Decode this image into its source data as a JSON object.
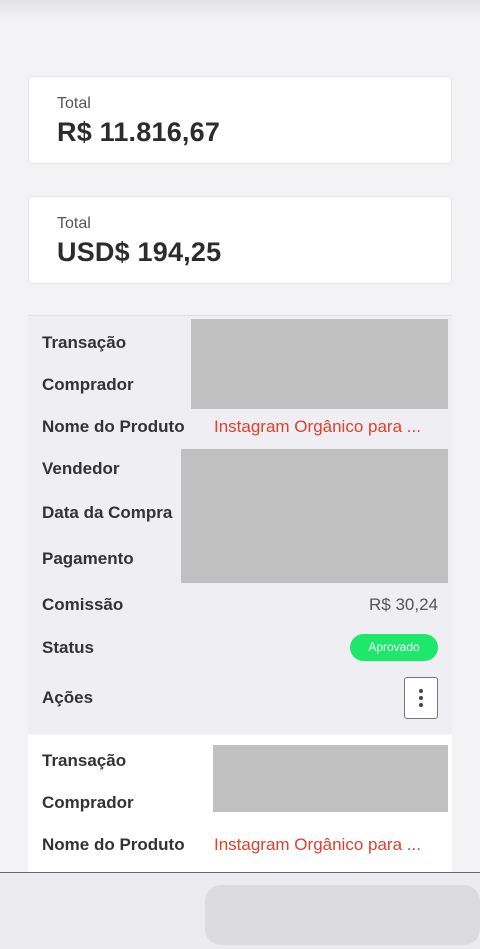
{
  "totals": [
    {
      "label": "Total",
      "value": "R$ 11.816,67"
    },
    {
      "label": "Total",
      "value": "USD$ 194,25"
    }
  ],
  "transactions": [
    {
      "labels": {
        "transaction": "Transação",
        "buyer": "Comprador",
        "product": "Nome do Produto",
        "seller": "Vendedor",
        "date": "Data da Compra",
        "payment": "Pagamento",
        "commission": "Comissão",
        "status": "Status",
        "actions": "Ações"
      },
      "product_name": "Instagram Orgânico para ...",
      "commission_value": "R$ 30,24",
      "status_value": "Aprovado"
    },
    {
      "labels": {
        "transaction": "Transação",
        "buyer": "Comprador",
        "product": "Nome do Produto"
      },
      "product_name": "Instagram Orgânico para ..."
    }
  ],
  "colors": {
    "link": "#e0402c",
    "status_approved": "#1ee86b",
    "redaction": "#c0c0c0"
  },
  "icons": {
    "actions": "kebab-menu-icon"
  }
}
